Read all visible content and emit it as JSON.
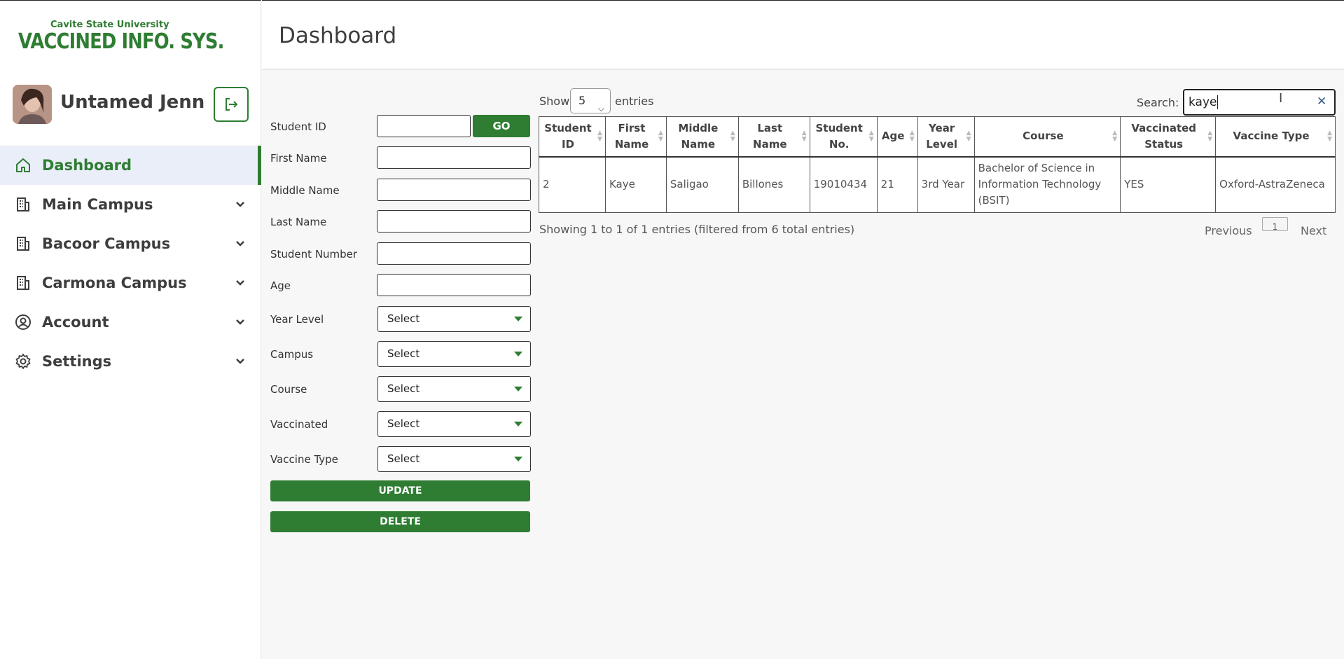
{
  "sidebar": {
    "logo": {
      "small": "Cavite State University",
      "big": "VACCINED INFO. SYS."
    },
    "user_name": "Untamed Jenn",
    "nav": [
      {
        "label": "Dashboard"
      },
      {
        "label": "Main Campus"
      },
      {
        "label": "Bacoor Campus"
      },
      {
        "label": "Carmona Campus"
      },
      {
        "label": "Account"
      },
      {
        "label": "Settings"
      }
    ]
  },
  "header": {
    "title": "Dashboard"
  },
  "form": {
    "student_id": "Student ID",
    "go": "GO",
    "first_name": "First Name",
    "middle_name": "Middle Name",
    "last_name": "Last Name",
    "student_number": "Student Number",
    "age": "Age",
    "year_level": "Year Level",
    "campus": "Campus",
    "course": "Course",
    "vaccinated": "Vaccinated",
    "vaccine_type": "Vaccine Type",
    "select_placeholder": "Select",
    "update": "UPDATE",
    "delete": "DELETE"
  },
  "table_controls": {
    "show": "Show",
    "entries_value": "5",
    "entries": "entries",
    "search_label": "Search:",
    "search_value": "kaye"
  },
  "table": {
    "headers": [
      [
        "Student",
        "ID"
      ],
      [
        "First",
        "Name"
      ],
      [
        "Middle",
        "Name"
      ],
      [
        "Last",
        "Name"
      ],
      [
        "Student",
        "No."
      ],
      [
        "Age"
      ],
      [
        "Year",
        "Level"
      ],
      [
        "Course"
      ],
      [
        "Vaccinated",
        "Status"
      ],
      [
        "Vaccine Type"
      ]
    ],
    "rows": [
      [
        "2",
        "Kaye",
        "Saligao",
        "Billones",
        "19010434",
        "21",
        "3rd Year",
        "Bachelor of Science in Information Technology (BSIT)",
        "YES",
        "Oxford-AstraZeneca"
      ]
    ]
  },
  "pagination": {
    "info": "Showing 1 to 1 of 1 entries (filtered from 6 total entries)",
    "previous": "Previous",
    "page": "1",
    "next": "Next"
  },
  "colors": {
    "accent": "#2e7d32",
    "active_nav_bg": "#e9eef8"
  }
}
